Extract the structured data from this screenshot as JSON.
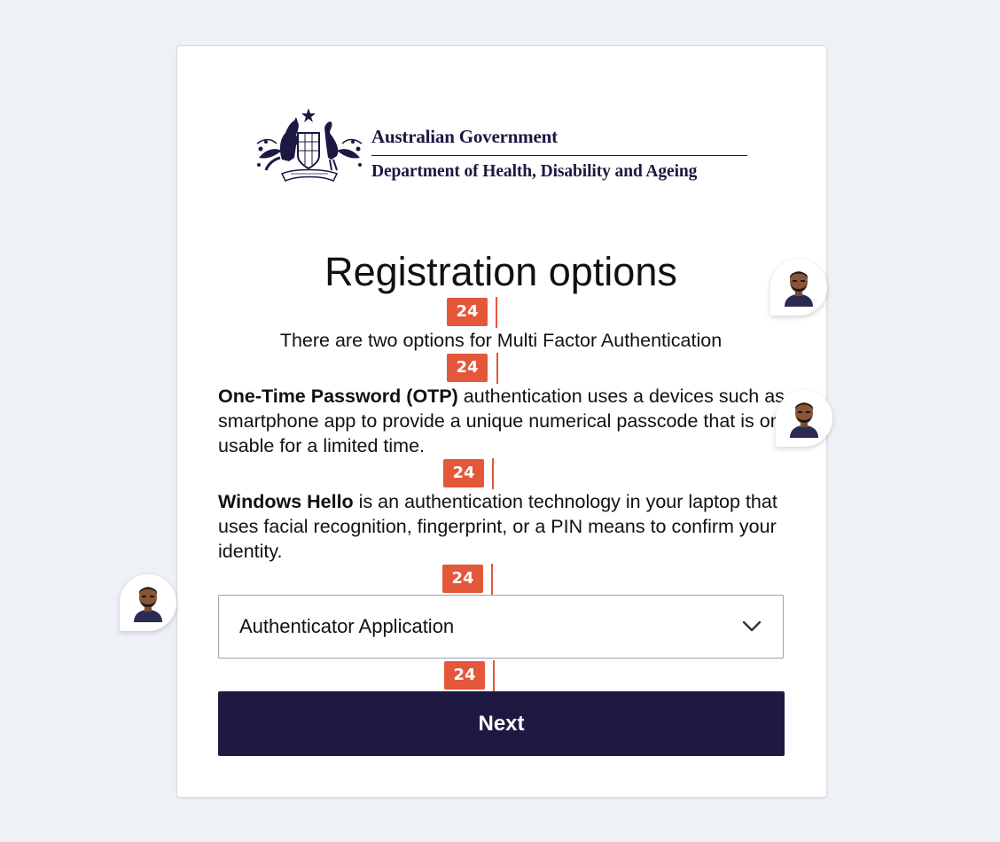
{
  "agency": {
    "line1": "Australian Government",
    "line2": "Department of Health, Disability and Ageing"
  },
  "page": {
    "title": "Registration options",
    "intro": "There are two options for Multi Factor Authentication",
    "otp_term": "One-Time Password (OTP)",
    "otp_text": " authentication uses a devices such as a smartphone app to provide a unique numerical passcode that is only usable for a limited time.",
    "hello_term": "Windows Hello",
    "hello_text": " is an authentication technology in your laptop that uses facial recognition, fingerprint, or a PIN means to confirm your identity."
  },
  "method_select": {
    "value": "Authenticator Application",
    "icon": "chevron-down-icon"
  },
  "next_button": {
    "label": "Next"
  },
  "annotations": {
    "spacing_label": "24",
    "color": "#e3573a"
  },
  "colors": {
    "brand_navy": "#1e1941",
    "background": "#eef2f7"
  }
}
